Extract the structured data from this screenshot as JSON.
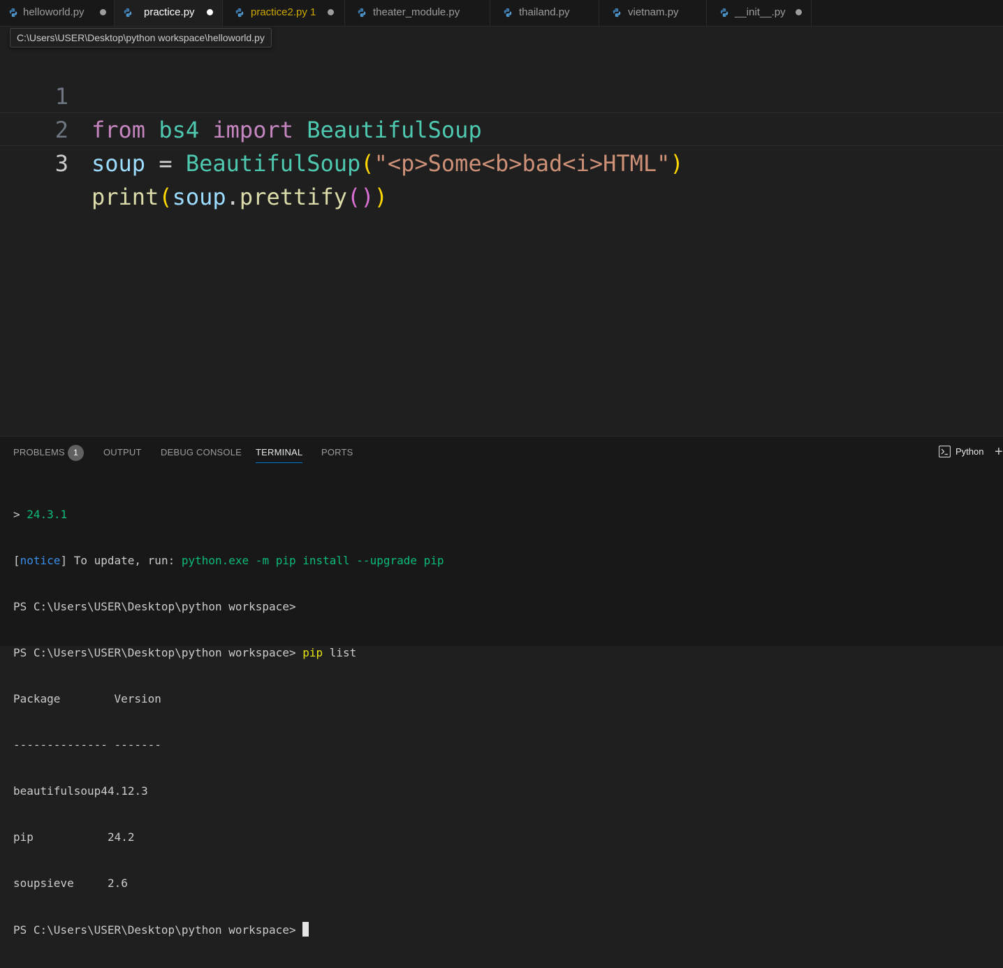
{
  "tabs": [
    {
      "label": "helloworld.py",
      "dirty": true,
      "active": false
    },
    {
      "label": "practice.py",
      "dirty": true,
      "active": true
    },
    {
      "label": "practice2.py",
      "count": "1",
      "dirty": true,
      "active": false,
      "warning": true
    },
    {
      "label": "theater_module.py",
      "dirty": false,
      "active": false
    },
    {
      "label": "thailand.py",
      "dirty": false,
      "active": false
    },
    {
      "label": "vietnam.py",
      "dirty": false,
      "active": false
    },
    {
      "label": "__init__.py",
      "dirty": true,
      "active": false
    }
  ],
  "tooltip": "C:\\Users\\USER\\Desktop\\python workspace\\helloworld.py",
  "editor": {
    "line_numbers": [
      "1",
      "2",
      "3"
    ],
    "line1": {
      "from": "from",
      "module": "bs4",
      "import": "import",
      "name": "BeautifulSoup"
    },
    "line2": {
      "var": "soup",
      "eq": "=",
      "cls": "BeautifulSoup",
      "open": "(",
      "str": "\"<p>Some<b>bad<i>HTML\"",
      "close": ")"
    },
    "line3": {
      "fn": "print",
      "open1": "(",
      "var": "soup",
      "dot": ".",
      "method": "prettify",
      "open2": "(",
      "close2": ")",
      "close1": ")"
    }
  },
  "panel": {
    "tabs": {
      "problems": "PROBLEMS",
      "output": "OUTPUT",
      "debug": "DEBUG CONSOLE",
      "terminal": "TERMINAL",
      "ports": "PORTS"
    },
    "problems_count": "1",
    "terminal_name": "Python",
    "plus": "+"
  },
  "terminal": {
    "l1_prompt": ">",
    "l1_version": "24.3.1",
    "l2_bracket_open": "[",
    "l2_notice": "notice",
    "l2_bracket_close": "]",
    "l2_text": " To update, run: ",
    "l2_cmd_exe": "python.exe",
    "l2_cmd_flag": " -m ",
    "l2_cmd_rest": "pip install ",
    "l2_cmd_opt": "--upgrade",
    "l2_cmd_tail": " pip",
    "l3": "PS C:\\Users\\USER\\Desktop\\python workspace>",
    "l4_prompt": "PS C:\\Users\\USER\\Desktop\\python workspace> ",
    "l4_cmd": "pip",
    "l4_args": " list",
    "header": "Package        Version",
    "separator": "-------------- -------",
    "packages": [
      {
        "name": "beautifulsoup4",
        "version": "4.12.3"
      },
      {
        "name": "pip",
        "version": "24.2"
      },
      {
        "name": "soupsieve",
        "version": "2.6"
      }
    ],
    "last_prompt": "PS C:\\Users\\USER\\Desktop\\python workspace> "
  }
}
